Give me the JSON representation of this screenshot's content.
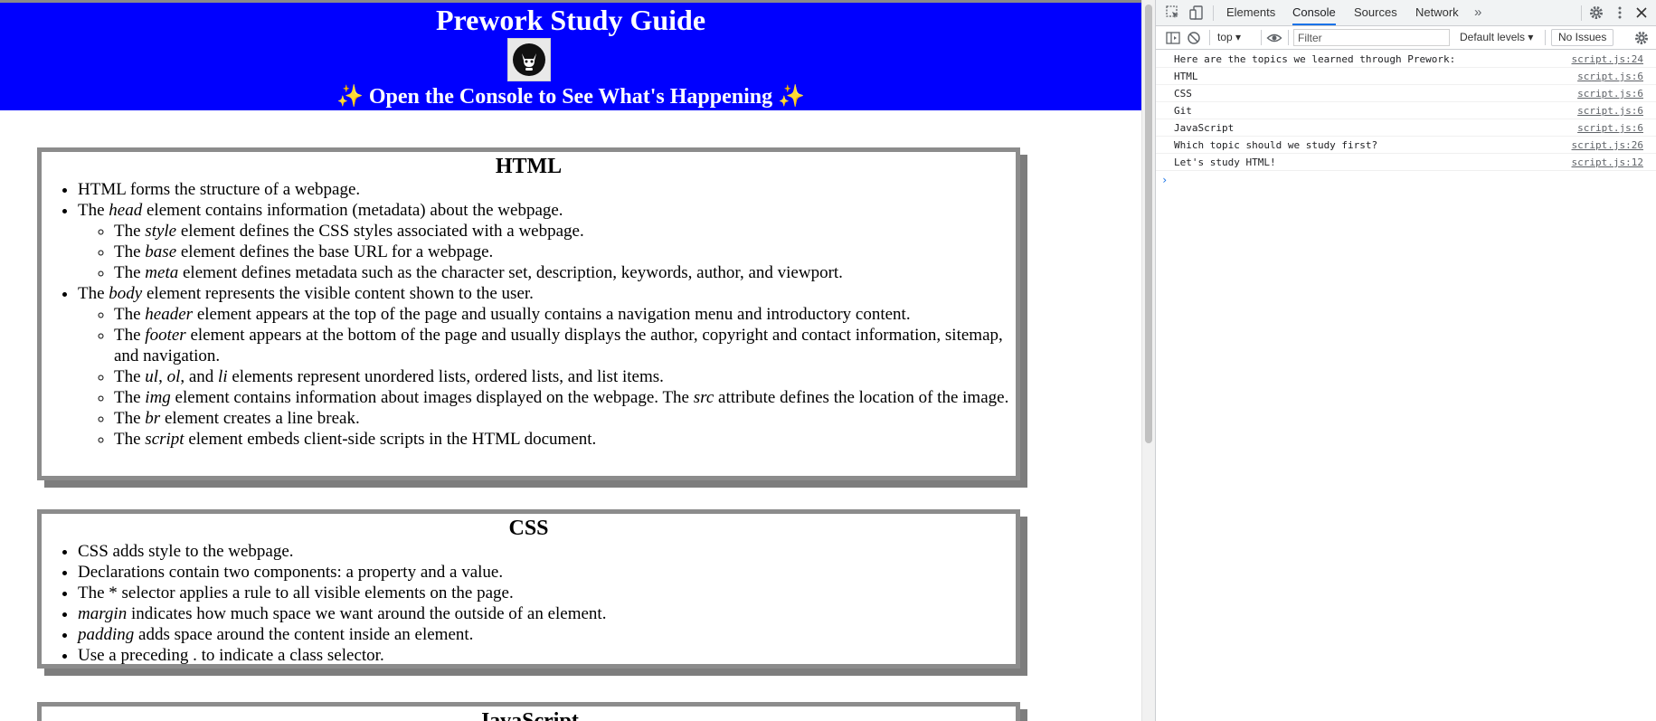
{
  "page": {
    "header": {
      "title": "Prework Study Guide",
      "subtitle": "✨ Open the Console to See What's Happening ✨",
      "logo_icon": "cat-avatar-icon"
    },
    "html_card": {
      "title": "HTML",
      "items": [
        {
          "text": "HTML forms the structure of a webpage."
        },
        {
          "pre": "The ",
          "em": "head",
          "post": " element contains information (metadata) about the webpage."
        },
        {
          "pre": "The ",
          "em": "style",
          "post": " element defines the CSS styles associated with a webpage."
        },
        {
          "pre": "The ",
          "em": "base",
          "post": " element defines the base URL for a webpage."
        },
        {
          "pre": "The ",
          "em": "meta",
          "post": " element defines metadata such as the character set, description, keywords, author, and viewport."
        },
        {
          "pre": "The ",
          "em": "body",
          "post": " element represents the visible content shown to the user."
        },
        {
          "pre": "The ",
          "em": "header",
          "post": " element appears at the top of the page and usually contains a navigation menu and introductory content."
        },
        {
          "pre": "The ",
          "em": "footer",
          "post": " element appears at the bottom of the page and usually displays the author, copyright and contact information, sitemap, and navigation."
        },
        {
          "pre": "The ",
          "em1": "ul",
          "sep1": ", ",
          "em2": "ol",
          "sep2": ", and ",
          "em3": "li",
          "post": " elements represent unordered lists, ordered lists, and list items."
        },
        {
          "pre": "The ",
          "em1": "img",
          "mid": " element contains information about images displayed on the webpage. The ",
          "em2": "src",
          "post": " attribute defines the location of the image."
        },
        {
          "pre": "The ",
          "em": "br",
          "post": " element creates a line break."
        },
        {
          "pre": "The ",
          "em": "script",
          "post": " element embeds client-side scripts in the HTML document."
        }
      ]
    },
    "css_card": {
      "title": "CSS",
      "items": [
        {
          "text": "CSS adds style to the webpage."
        },
        {
          "text": "Declarations contain two components: a property and a value."
        },
        {
          "text": "The * selector applies a rule to all visible elements on the page."
        },
        {
          "em": "margin",
          "post": " indicates how much space we want around the outside of an element."
        },
        {
          "em": "padding",
          "post": " adds space around the content inside an element."
        },
        {
          "text": "Use a preceding . to indicate a class selector."
        }
      ]
    },
    "js_card": {
      "title": "JavaScript"
    }
  },
  "devtools": {
    "tabs": [
      "Elements",
      "Console",
      "Sources",
      "Network"
    ],
    "active_tab": "Console",
    "more_tabs_label": "»",
    "icons": {
      "inspect": "inspect-element-icon",
      "device": "device-toolbar-icon",
      "settings": "settings-gear-icon",
      "menu": "more-vert-icon",
      "close": "close-icon",
      "sidebar": "console-sidebar-icon",
      "clear": "clear-console-icon",
      "eye": "live-expression-eye-icon",
      "toolbar_settings": "console-settings-icon"
    },
    "toolbar": {
      "context": "top ▾",
      "filter_placeholder": "Filter",
      "levels": "Default levels ▾",
      "issues": "No Issues"
    },
    "console": [
      {
        "message": "Here are the topics we learned through Prework:",
        "source": "script.js:24"
      },
      {
        "message": "HTML",
        "source": "script.js:6"
      },
      {
        "message": "CSS",
        "source": "script.js:6"
      },
      {
        "message": "Git",
        "source": "script.js:6"
      },
      {
        "message": "JavaScript",
        "source": "script.js:6"
      },
      {
        "message": "Which topic should we study first?",
        "source": "script.js:26"
      },
      {
        "message": "Let's study HTML!",
        "source": "script.js:12"
      }
    ],
    "prompt_caret": "›",
    "accent": "#1a73e8"
  },
  "colors": {
    "header_bg": "#0000ff",
    "header_text": "#ffffff",
    "card_border": "#8c8c8c"
  }
}
